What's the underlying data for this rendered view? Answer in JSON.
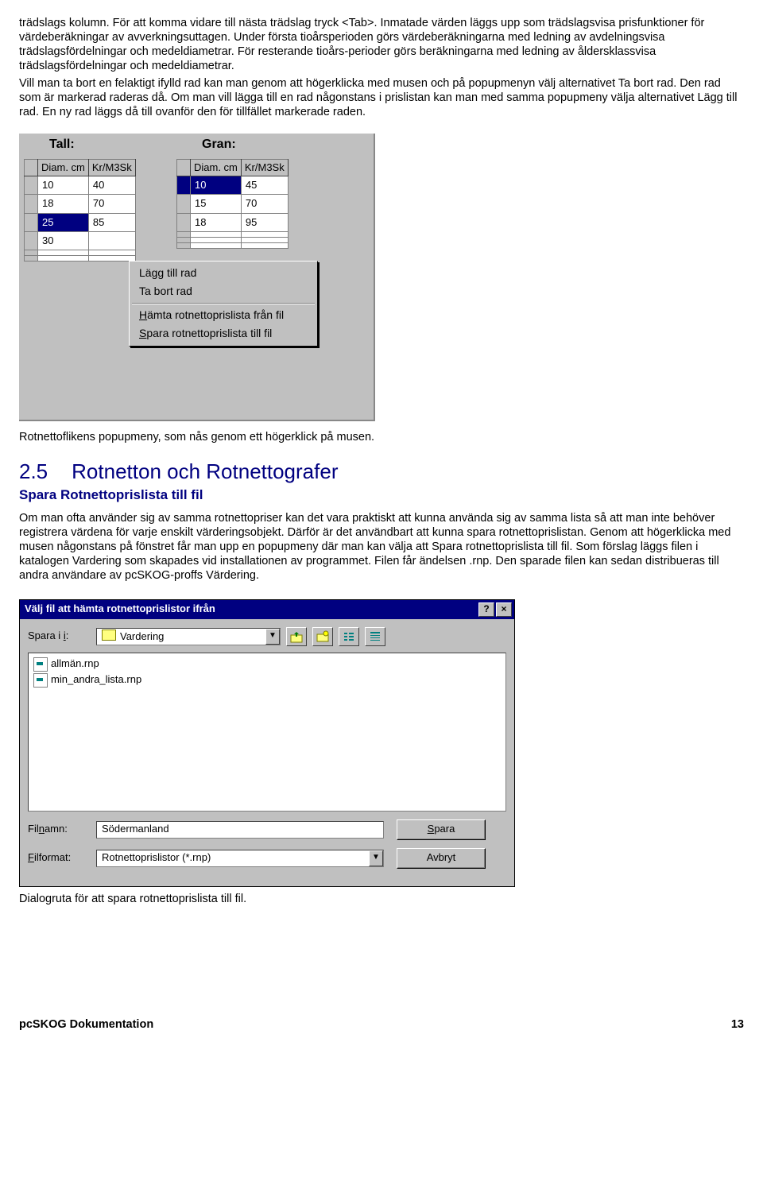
{
  "intro_para": "trädslags kolumn. För att komma vidare till nästa trädslag tryck <Tab>. Inmatade värden läggs upp som trädslagsvisa prisfunktioner för värdeberäkningar av avverkningsuttagen. Under första tioårsperioden görs värdeberäkningarna med ledning av avdelningsvisa trädslagsfördelningar och medeldiametrar. För resterande tioårs-perioder görs beräkningarna med ledning av åldersklassvisa trädslagsfördelningar och medeldiametrar.",
  "intro_para2": "Vill man ta bort en felaktigt ifylld rad kan man genom att högerklicka med musen och på popupmenyn välj alternativet Ta bort rad. Den rad som är markerad raderas då. Om man vill lägga till en rad någonstans i prislistan kan man med samma popupmeny välja alternativet Lägg till rad. En ny rad läggs då till ovanför den för tillfället markerade raden.",
  "shot1": {
    "tall_label": "Tall:",
    "gran_label": "Gran:",
    "col1": "Diam. cm",
    "col2": "Kr/M3Sk",
    "tall_rows": [
      [
        "10",
        "40"
      ],
      [
        "18",
        "70"
      ],
      [
        "25",
        "85"
      ],
      [
        "30",
        ""
      ]
    ],
    "gran_rows": [
      [
        "10",
        "45"
      ],
      [
        "15",
        "70"
      ],
      [
        "18",
        "95"
      ]
    ],
    "popup": {
      "add": "Lägg till rad",
      "del": "Ta bort rad",
      "load_pre": "H",
      "load_rest": "ämta rotnettoprislista från fil",
      "save_pre": "S",
      "save_rest": "para rotnettoprislista till fil"
    }
  },
  "caption1": "Rotnettoflikens popupmeny, som nås genom ett högerklick på musen.",
  "section": {
    "num": "2.5",
    "title": "Rotnetton och Rotnettografer"
  },
  "subhead": "Spara Rotnettoprislista till fil",
  "body_para": "Om man ofta använder sig av samma rotnettopriser kan det vara praktiskt att kunna använda sig av samma lista så att man inte behöver registrera värdena för varje enskilt värderingsobjekt. Därför är det användbart att kunna spara rotnettoprislistan. Genom att högerklicka med musen någonstans på fönstret får man upp en popupmeny där man kan välja att Spara rotnettoprislista till fil. Som förslag läggs filen i katalogen Vardering som skapades vid installationen av programmet. Filen får ändelsen .rnp. Den sparade filen kan sedan distribueras till andra användare av pcSKOG-proffs Värdering.",
  "dlg": {
    "title": "Välj fil att hämta rotnettoprislistor ifrån",
    "help": "?",
    "close": "×",
    "save_in_lbl": "Spara i",
    "folder": "Vardering",
    "files": [
      "allmän.rnp",
      "min_andra_lista.rnp"
    ],
    "filename_lbl": "Filnamn",
    "filename_val": "Södermanland",
    "format_lbl": "Filformat",
    "format_val": "Rotnettoprislistor (*.rnp)",
    "save_btn": "Spara",
    "cancel_btn": "Avbryt"
  },
  "caption2": "Dialogruta för att spara rotnettoprislista till fil.",
  "footer": {
    "left": "pcSKOG Dokumentation",
    "right": "13"
  }
}
